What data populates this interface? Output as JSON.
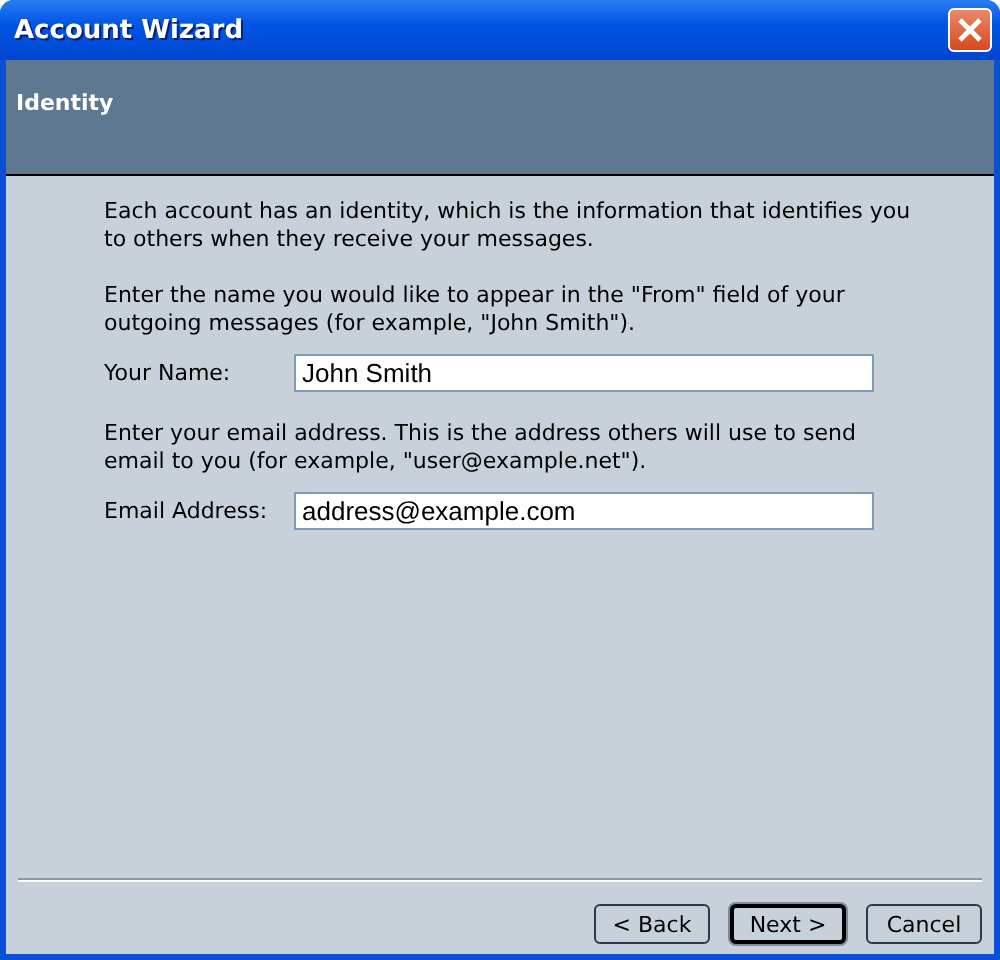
{
  "window": {
    "title": "Account Wizard"
  },
  "page": {
    "title": "Identity"
  },
  "intro": "Each account has an identity, which is the information that identifies you to others when they receive your messages.",
  "sections": [
    {
      "description": "Enter the name you would like to appear in the \"From\" field of your outgoing messages (for example, \"John Smith\").",
      "label": "Your Name:",
      "value": "John Smith"
    },
    {
      "description": "Enter your email address. This is the address others will use to send email to you (for example, \"user@example.net\").",
      "label": "Email Address:",
      "value": "address@example.com"
    }
  ],
  "buttons": [
    {
      "label": "< Back",
      "default": false
    },
    {
      "label": "Next >",
      "default": true
    },
    {
      "label": "Cancel",
      "default": false
    }
  ]
}
